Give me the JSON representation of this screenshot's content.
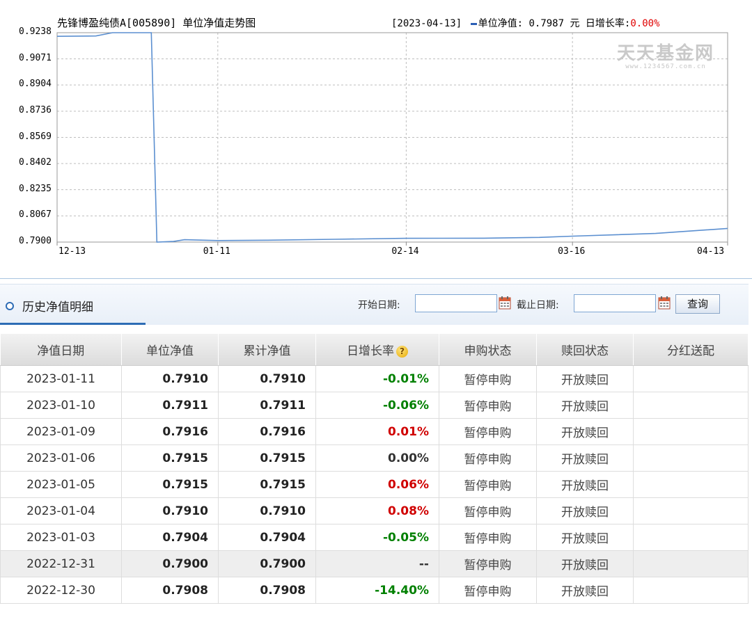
{
  "chart": {
    "title": "先锋博盈纯债A[005890] 单位净值走势图",
    "info_date": "[2023-04-13]",
    "info_label": "单位净值:",
    "info_value": "0.7987 元",
    "info_rate_label": "日增长率:",
    "info_rate_value": "0.00%",
    "watermark_main": "天天基金网",
    "watermark_sub": "www.1234567.com.cn",
    "colors": {
      "line": "#5b8fd0",
      "grid": "#bdbdbd",
      "rate": "#e00000"
    }
  },
  "chart_data": {
    "type": "line",
    "y_ticks": [
      "0.9238",
      "0.9071",
      "0.8904",
      "0.8736",
      "0.8569",
      "0.8402",
      "0.8235",
      "0.8067",
      "0.7900"
    ],
    "ylim": [
      0.79,
      0.9238
    ],
    "x_ticks": [
      "12-13",
      "01-11",
      "02-14",
      "03-16",
      "04-13"
    ],
    "x_tick_dates": [
      "2022-12-13",
      "2023-01-11",
      "2023-02-14",
      "2023-03-16",
      "2023-04-13"
    ],
    "xlim": [
      "2022-12-13",
      "2023-04-13"
    ],
    "grid": true,
    "series": [
      {
        "x": [
          "2022-12-13",
          "2022-12-20",
          "2022-12-23",
          "2022-12-30",
          "2022-12-31",
          "2023-01-03",
          "2023-01-05",
          "2023-01-11",
          "2023-01-20",
          "2023-02-01",
          "2023-02-14",
          "2023-02-28",
          "2023-03-10",
          "2023-03-16",
          "2023-03-31",
          "2023-04-13"
        ],
        "y": [
          0.9215,
          0.9217,
          0.9238,
          0.9238,
          0.79,
          0.7904,
          0.7915,
          0.791,
          0.7912,
          0.7918,
          0.7924,
          0.7925,
          0.793,
          0.7938,
          0.7955,
          0.7987
        ]
      }
    ]
  },
  "history": {
    "title": "历史净值明细",
    "start_label": "开始日期:",
    "start_value": "",
    "end_label": "截止日期:",
    "end_value": "",
    "query_label": "查询"
  },
  "table": {
    "headers": [
      "净值日期",
      "单位净值",
      "累计净值",
      "日增长率",
      "申购状态",
      "赎回状态",
      "分红送配"
    ],
    "rows": [
      {
        "date": "2023-01-11",
        "nav": "0.7910",
        "acc": "0.7910",
        "rate": "-0.01%",
        "dir": "down",
        "buy": "暂停申购",
        "sell": "开放赎回",
        "div": ""
      },
      {
        "date": "2023-01-10",
        "nav": "0.7911",
        "acc": "0.7911",
        "rate": "-0.06%",
        "dir": "down",
        "buy": "暂停申购",
        "sell": "开放赎回",
        "div": ""
      },
      {
        "date": "2023-01-09",
        "nav": "0.7916",
        "acc": "0.7916",
        "rate": "0.01%",
        "dir": "up",
        "buy": "暂停申购",
        "sell": "开放赎回",
        "div": ""
      },
      {
        "date": "2023-01-06",
        "nav": "0.7915",
        "acc": "0.7915",
        "rate": "0.00%",
        "dir": "flat",
        "buy": "暂停申购",
        "sell": "开放赎回",
        "div": ""
      },
      {
        "date": "2023-01-05",
        "nav": "0.7915",
        "acc": "0.7915",
        "rate": "0.06%",
        "dir": "up",
        "buy": "暂停申购",
        "sell": "开放赎回",
        "div": ""
      },
      {
        "date": "2023-01-04",
        "nav": "0.7910",
        "acc": "0.7910",
        "rate": "0.08%",
        "dir": "up",
        "buy": "暂停申购",
        "sell": "开放赎回",
        "div": ""
      },
      {
        "date": "2023-01-03",
        "nav": "0.7904",
        "acc": "0.7904",
        "rate": "-0.05%",
        "dir": "down",
        "buy": "暂停申购",
        "sell": "开放赎回",
        "div": ""
      },
      {
        "date": "2022-12-31",
        "nav": "0.7900",
        "acc": "0.7900",
        "rate": "--",
        "dir": "flat",
        "buy": "暂停申购",
        "sell": "开放赎回",
        "div": "",
        "highlight": true
      },
      {
        "date": "2022-12-30",
        "nav": "0.7908",
        "acc": "0.7908",
        "rate": "-14.40%",
        "dir": "down",
        "buy": "暂停申购",
        "sell": "开放赎回",
        "div": ""
      }
    ]
  }
}
